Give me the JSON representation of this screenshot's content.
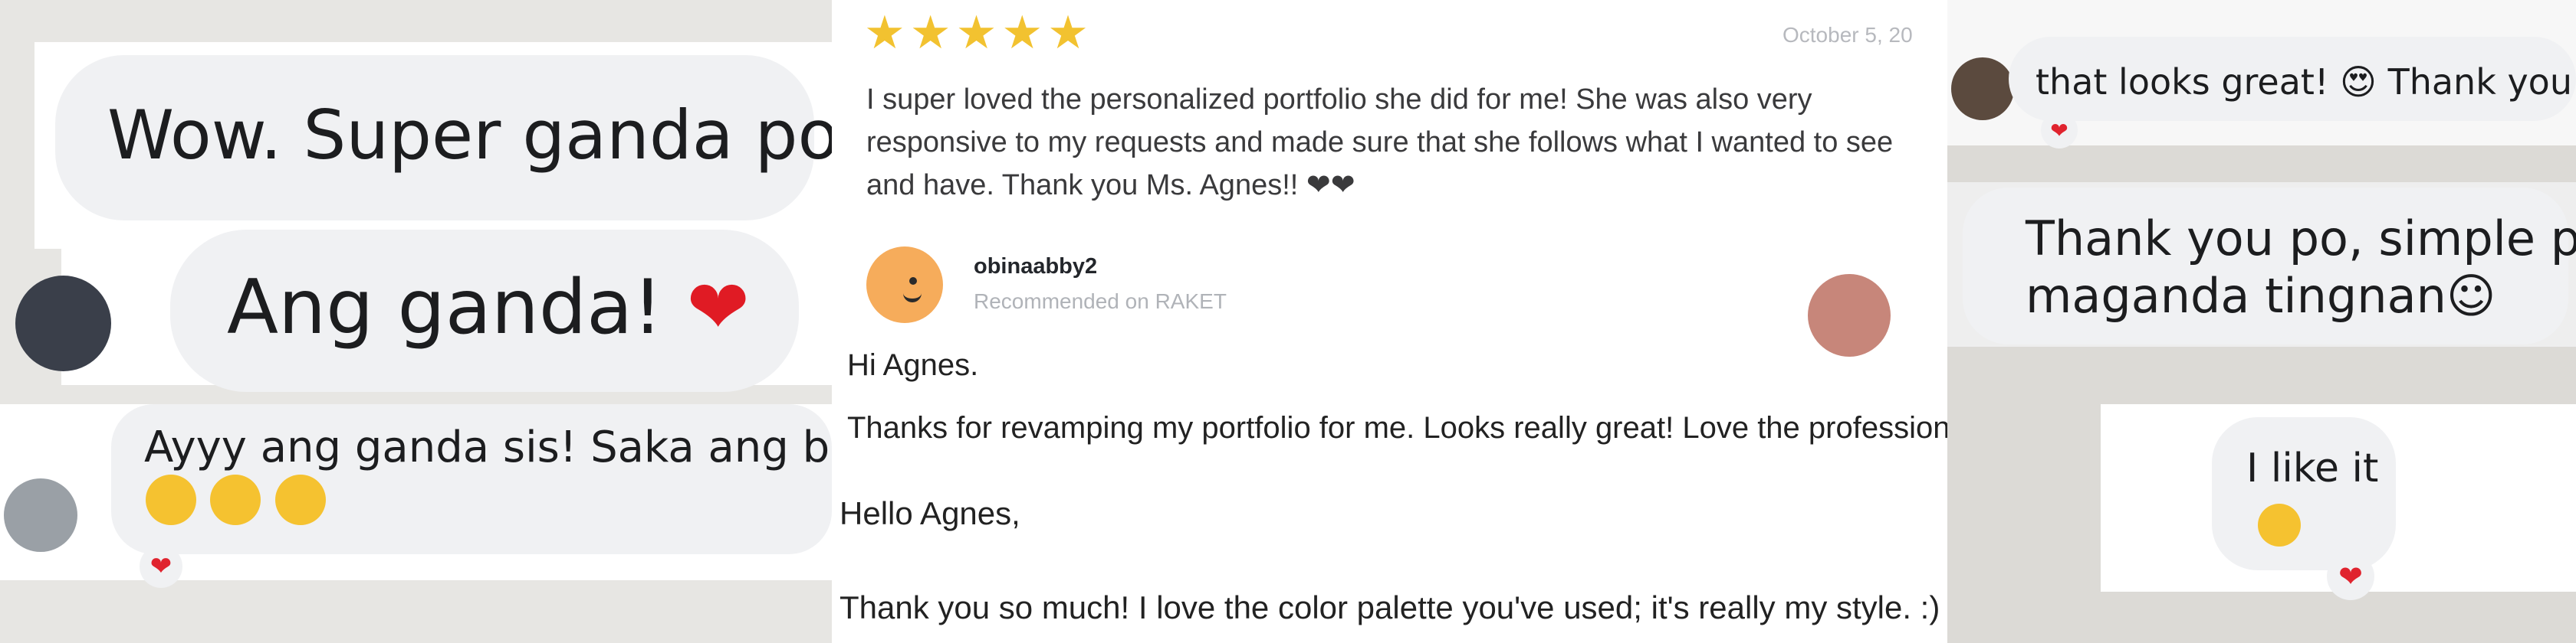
{
  "left": {
    "bubble1": "Wow. Super ganda po",
    "bubble2": "Ang ganda! ",
    "bubble2_heart": "❤",
    "bubble3_line1": "Ayyy ang ganda sis! Saka ang bilis",
    "bubble3_line2": "😍 😍 😍",
    "reaction": "❤"
  },
  "review": {
    "rating_stars": "★★★★★",
    "rating_value": 5,
    "date": "October 5, 20",
    "text": "I super loved the personalized portfolio she did for me! She was also very responsive to my requests and made sure that she follows what I wanted to see and have. Thank you Ms. Agnes!! ❤❤",
    "reviewer_name": "obinaabby2",
    "reviewer_subtitle": "Recommended on RAKET"
  },
  "email1": {
    "greeting": "Hi Agnes.",
    "body": "Thanks for revamping my portfolio for me. Looks really great! Love the professionalism too!"
  },
  "email2": {
    "greeting": "Hello Agnes,",
    "body": "Thank you so much! I love the color palette you've used; it's really my style. :)"
  },
  "right": {
    "bubble1": "that looks great! 😍 Thank you po!",
    "reaction1": "❤",
    "bubble2_line1": "Thank you po, simple pero",
    "bubble2_line2": "maganda tingnan☺",
    "bubble3_line1": "I like it",
    "bubble3_line2": "🥰",
    "reaction3": "❤"
  },
  "colors": {
    "star": "#f2c230",
    "heart": "#e01b24",
    "bubble": "#f0f1f3"
  }
}
